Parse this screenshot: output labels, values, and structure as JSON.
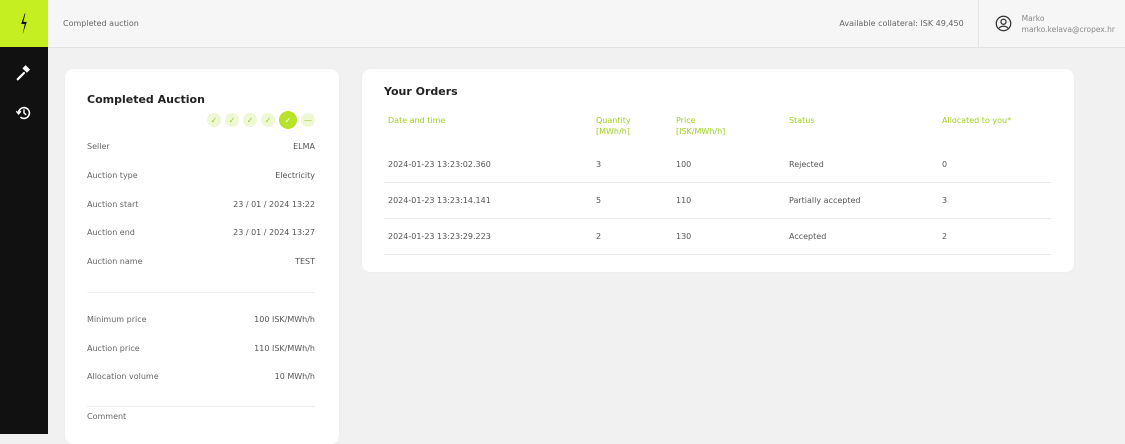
{
  "header": {
    "breadcrumb": "Completed auction",
    "collateral": "Available collateral: ISK 49,450",
    "user_name": "Marko",
    "user_email": "marko.kelava@cropex.hr"
  },
  "sidebar": {
    "logo_icon": "lightning-bolt-icon",
    "items": [
      {
        "icon": "gavel-icon"
      },
      {
        "icon": "history-icon"
      }
    ]
  },
  "auction": {
    "title": "Completed Auction",
    "steps": [
      {
        "state": "done"
      },
      {
        "state": "done"
      },
      {
        "state": "done"
      },
      {
        "state": "done"
      },
      {
        "state": "current"
      },
      {
        "state": "pending"
      }
    ],
    "seller_label": "Seller",
    "seller": "ELMA",
    "type_label": "Auction type",
    "type": "Electricity",
    "start_label": "Auction start",
    "start": "23 / 01 / 2024 13:22",
    "end_label": "Auction end",
    "end": "23 / 01 / 2024 13:27",
    "name_label": "Auction name",
    "name": "TEST",
    "min_price_label": "Minimum price",
    "min_price": "100 ISK/MWh/h",
    "auction_price_label": "Auction price",
    "auction_price": "110 ISK/MWh/h",
    "volume_label": "Allocation volume",
    "volume": "10 MWh/h",
    "comment_label": "Comment"
  },
  "orders": {
    "title": "Your Orders",
    "headers": {
      "date": "Date and time",
      "qty_1": "Quantity",
      "qty_2": "[MWh/h]",
      "price_1": "Price",
      "price_2": "[ISK/MWh/h]",
      "status": "Status",
      "allocated": "Allocated to you*"
    },
    "rows": [
      {
        "date": "2024-01-23 13:23:02.360",
        "qty": "3",
        "price": "100",
        "status": "Rejected",
        "allocated": "0"
      },
      {
        "date": "2024-01-23 13:23:14.141",
        "qty": "5",
        "price": "110",
        "status": "Partially accepted",
        "allocated": "3"
      },
      {
        "date": "2024-01-23 13:23:29.223",
        "qty": "2",
        "price": "130",
        "status": "Accepted",
        "allocated": "2"
      }
    ]
  },
  "colors": {
    "accent": "#c6ef22",
    "accent_text": "#9fcf1d",
    "sidebar": "#111111"
  }
}
